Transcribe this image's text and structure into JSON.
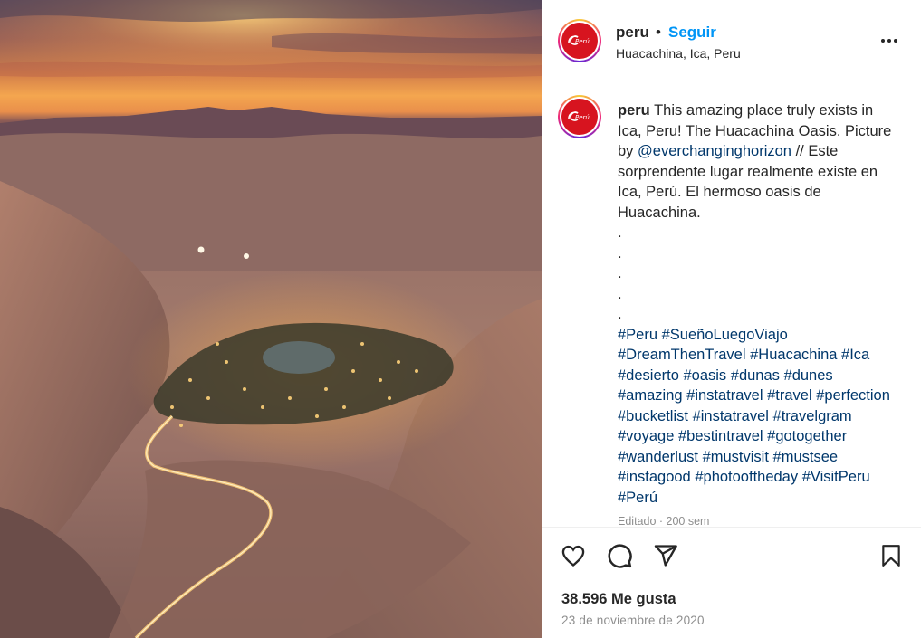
{
  "photo": {
    "description_icon": "landscape-image"
  },
  "header": {
    "username": "peru",
    "separator": "•",
    "follow_label": "Seguir",
    "location": "Huacachina, Ica, Peru",
    "more_icon": "more-horizontal-icon",
    "avatar_logo_text": "Perú"
  },
  "caption": {
    "username": "peru",
    "text_part1": "This amazing place truly exists in Ica, Peru! The Huacachina Oasis. Picture by",
    "mention": "@everchanginghorizon",
    "text_part2": "// Este sorprendente lugar realmente existe en Ica, Perú. El hermoso oasis de Huacachina.",
    "dots": [
      ".",
      ".",
      ".",
      ".",
      "."
    ],
    "hashtags": [
      "#Peru",
      "#SueñoLuegoViajo",
      "#DreamThenTravel",
      "#Huacachina",
      "#Ica",
      "#desierto",
      "#oasis",
      "#dunas",
      "#dunes",
      "#amazing",
      "#instatravel",
      "#travel",
      "#perfection",
      "#bucketlist",
      "#instatravel",
      "#travelgram",
      "#voyage",
      "#bestintravel",
      "#gotogether",
      "#wanderlust",
      "#mustvisit",
      "#mustsee",
      "#instagood",
      "#photooftheday",
      "#VisitPeru",
      "#Perú"
    ],
    "edited": "Editado · 200 sem"
  },
  "actions": {
    "like_icon": "heart-icon",
    "comment_icon": "comment-icon",
    "share_icon": "share-icon",
    "save_icon": "bookmark-icon",
    "likes_text": "38.596 Me gusta",
    "date": "23 de noviembre de 2020"
  },
  "colors": {
    "accent": "#0095f6",
    "link": "#00376b",
    "brand_red": "#d7141f",
    "muted": "#8e8e8e"
  }
}
